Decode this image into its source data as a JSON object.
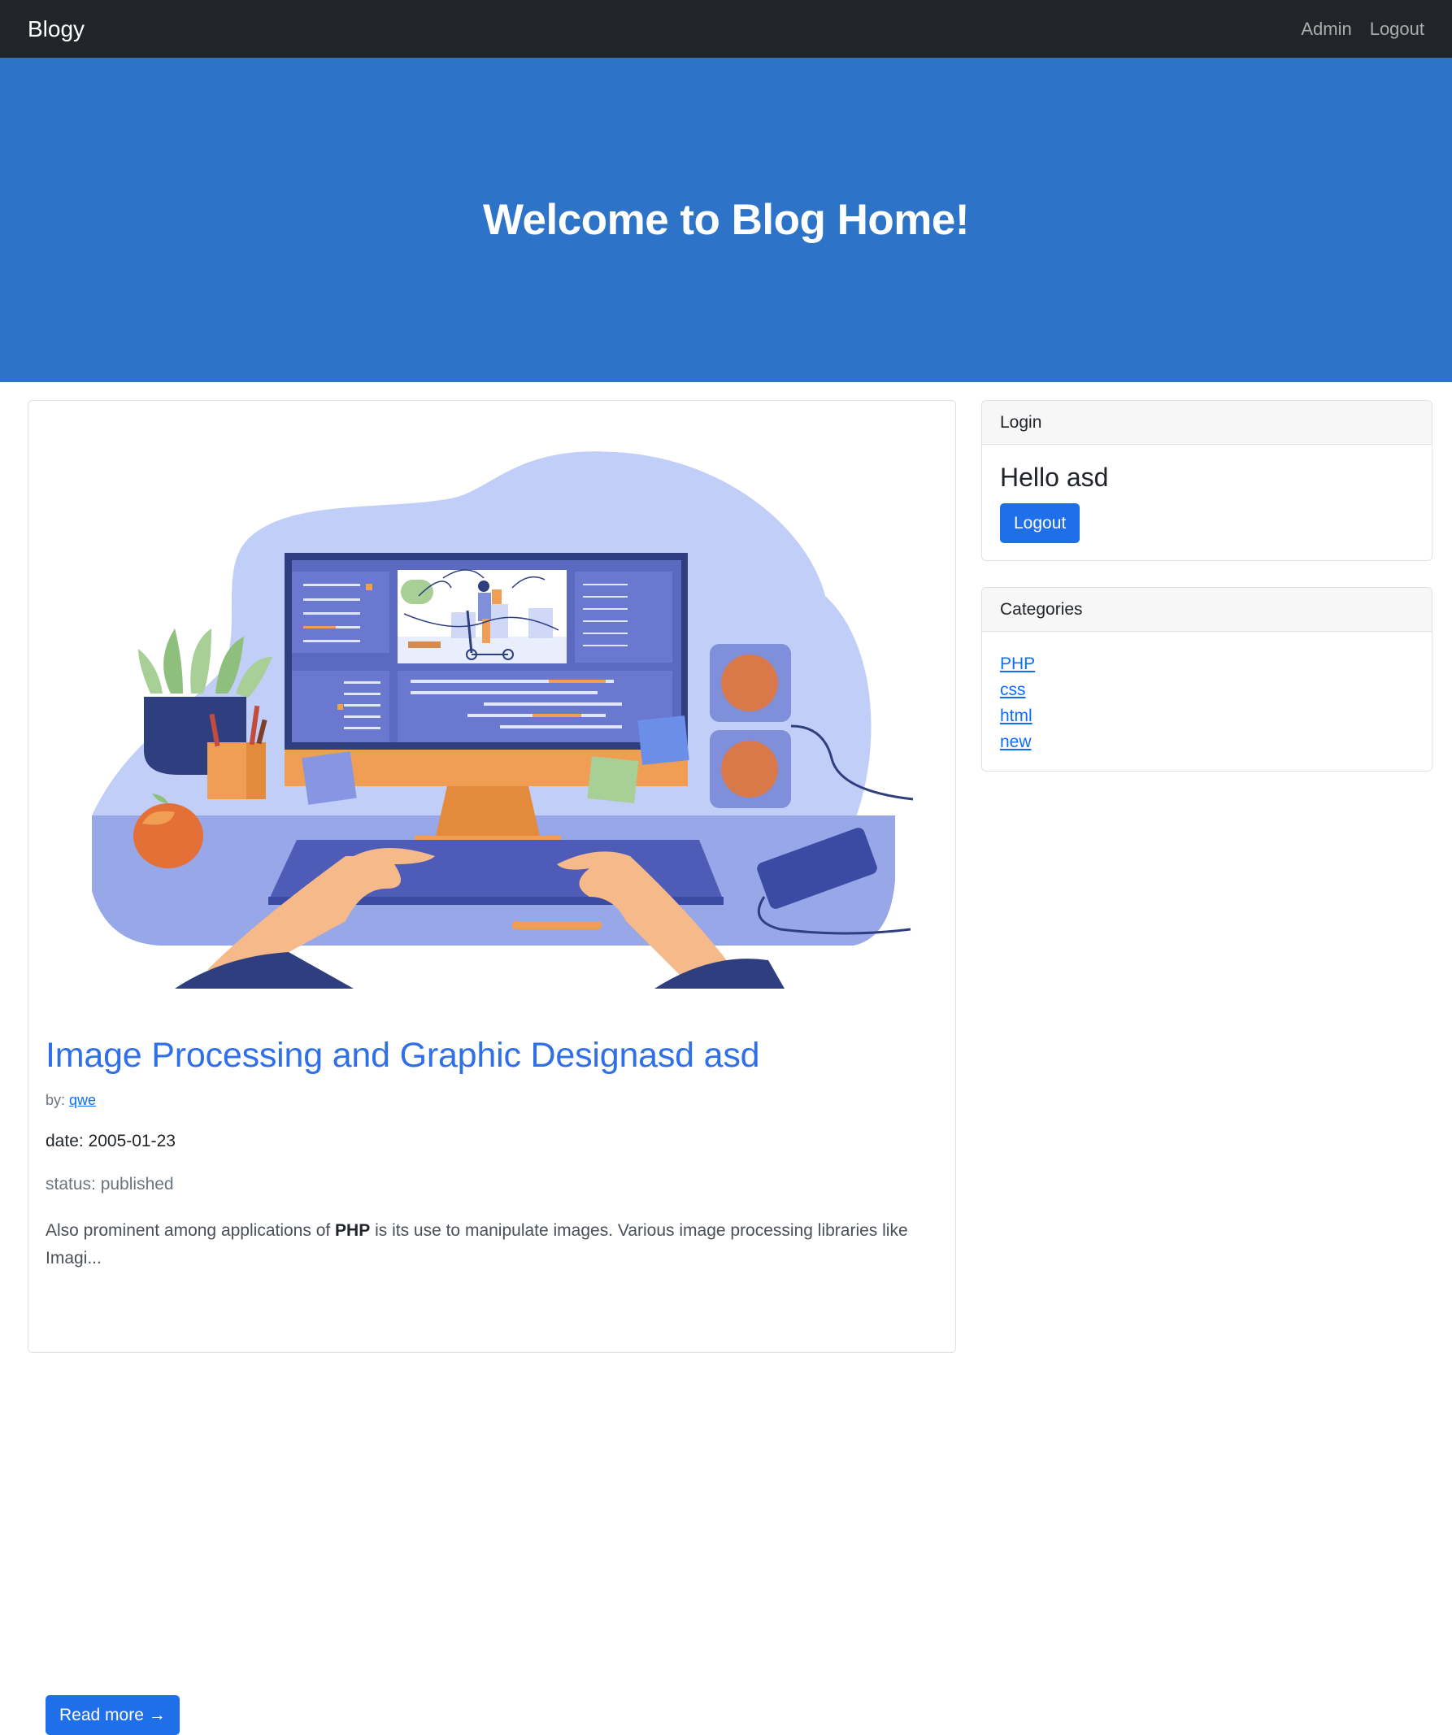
{
  "navbar": {
    "brand": "Blogy",
    "links": [
      "Admin",
      "Logout"
    ]
  },
  "hero": {
    "title": "Welcome to Blog Home!"
  },
  "post": {
    "image_alt": "illustration of a person editing video on a desktop computer",
    "title": "Image Processing and Graphic Designasd asd",
    "author_prefix": "by: ",
    "author": "qwe",
    "date": "date: 2005-01-23",
    "status": "status: published",
    "excerpt_before": "Also prominent among applications of ",
    "excerpt_bold": "PHP",
    "excerpt_after": " is its use to manipulate images. Various image processing libraries like Imagi...",
    "read_more": "Read more →"
  },
  "login": {
    "header": "Login",
    "greeting": "Hello asd",
    "button": "Logout"
  },
  "categories": {
    "header": "Categories",
    "items": [
      "PHP",
      "css",
      "html",
      "new"
    ]
  },
  "colors": {
    "navbar_bg": "#212529",
    "hero_bg": "#2d73c8",
    "primary": "#1f6fe8",
    "link": "#0d6efd"
  }
}
